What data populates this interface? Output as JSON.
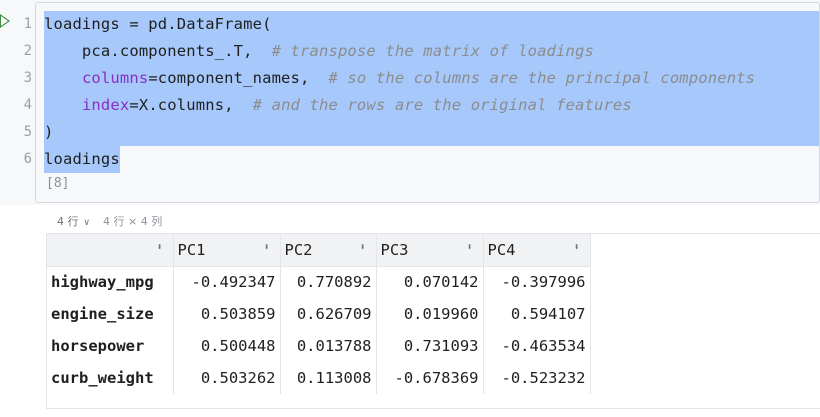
{
  "cell": {
    "execution_count": "[8]",
    "line_numbers": [
      "1",
      "2",
      "3",
      "4",
      "5",
      "6"
    ],
    "code": {
      "line1": "loadings = pd.DataFrame(",
      "line2_code": "    pca.components_.T,  ",
      "line2_comment": "# transpose the matrix of loadings",
      "line3_kw": "columns",
      "line3_code": "=component_names,  ",
      "line3_comment": "# so the columns are the principal components",
      "line4_kw": "index",
      "line4_code": "=X.columns,  ",
      "line4_comment": "# and the rows are the original features",
      "line5": ")",
      "line6": "loadings"
    }
  },
  "output": {
    "rows_dropdown": "4 行",
    "shape": "4 行 × 4 列",
    "table": {
      "index_header": "",
      "columns": [
        "PC1",
        "PC2",
        "PC3",
        "PC4"
      ],
      "rows": [
        {
          "index": "highway_mpg",
          "values": [
            "-0.492347",
            "0.770892",
            "0.070142",
            "-0.397996"
          ]
        },
        {
          "index": "engine_size",
          "values": [
            "0.503859",
            "0.626709",
            "0.019960",
            "0.594107"
          ]
        },
        {
          "index": "horsepower",
          "values": [
            "0.500448",
            "0.013788",
            "0.731093",
            "-0.463534"
          ]
        },
        {
          "index": "curb_weight",
          "values": [
            "0.503262",
            "0.113008",
            "-0.678369",
            "-0.523232"
          ]
        }
      ]
    }
  },
  "icons": {
    "run_indicator": "run-arrow-icon",
    "sort": "sort-icon",
    "dropdown": "chevron-down-icon"
  },
  "colors": {
    "selection": "#a6c8fb",
    "keyword": "#8a2fc7",
    "comment": "#8c8c8c",
    "run_indicator": "#3d8b3d"
  }
}
